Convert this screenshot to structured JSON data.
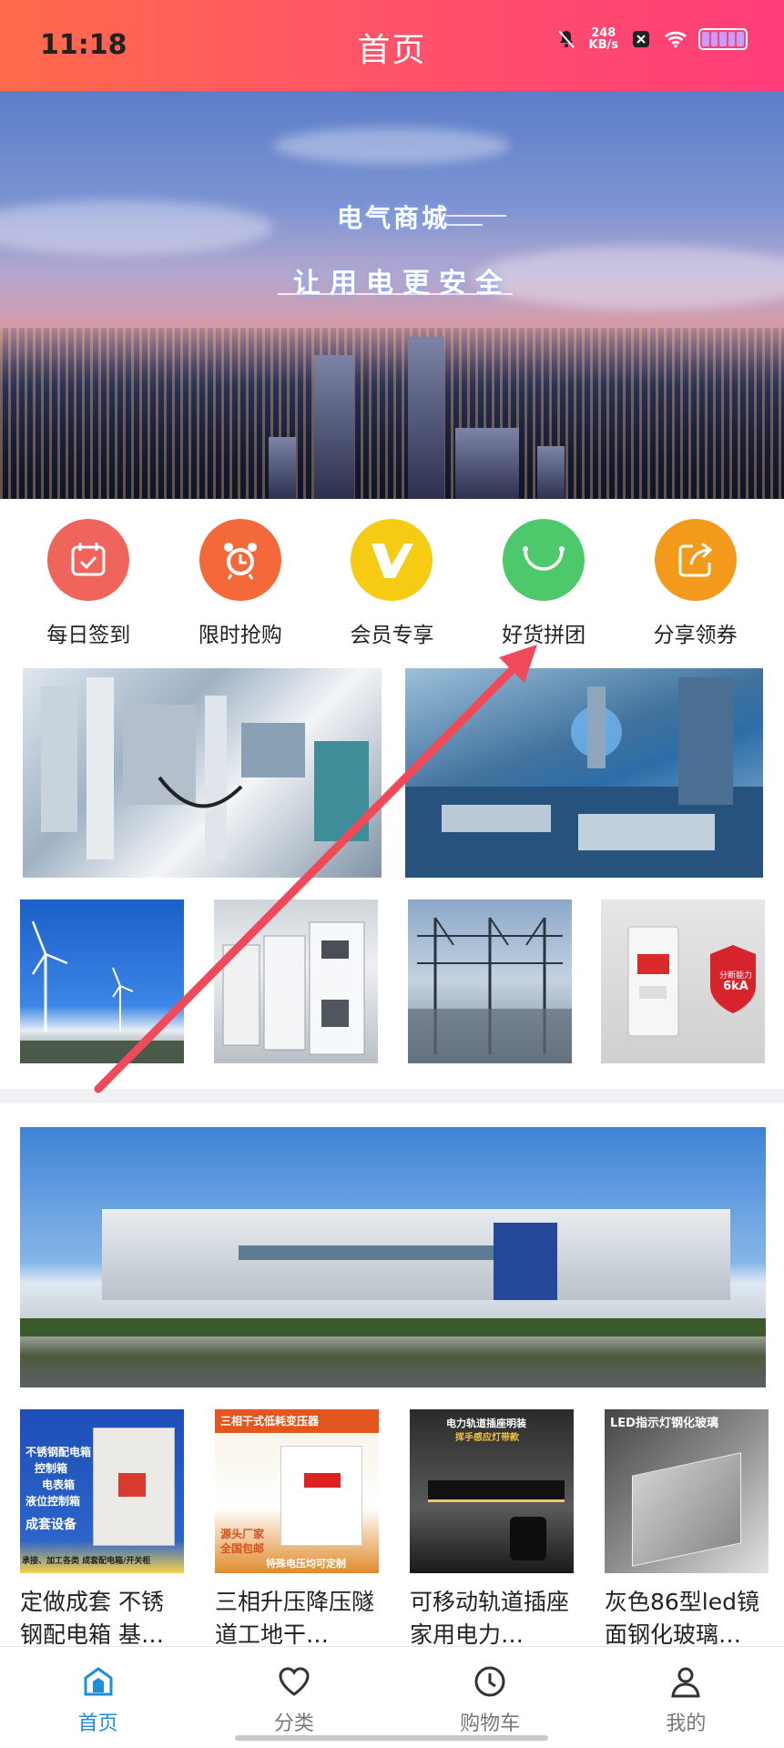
{
  "status": {
    "time": "11:18",
    "net_speed_value": "248",
    "net_speed_unit": "KB/s"
  },
  "header": {
    "title": "首页"
  },
  "hero": {
    "title": "电气商城",
    "subtitle": "让用电更安全"
  },
  "quick_actions": [
    {
      "label": "每日签到",
      "icon": "calendar-check-icon",
      "color": "#f0655b"
    },
    {
      "label": "限时抢购",
      "icon": "alarm-clock-icon",
      "color": "#f4693a"
    },
    {
      "label": "会员专享",
      "icon": "v-badge-icon",
      "color": "#f6cb14"
    },
    {
      "label": "好货拼团",
      "icon": "smile-bag-icon",
      "color": "#4dc86a"
    },
    {
      "label": "分享领券",
      "icon": "share-icon",
      "color": "#f39a1d"
    }
  ],
  "image_tiles": {
    "tile_breaker_badge_line1": "分断能力",
    "tile_breaker_badge_line2": "6kA"
  },
  "products": [
    {
      "title": "定做成套 不锈钢配电箱 基…",
      "img_lines": [
        "不锈钢配电箱",
        "控制箱",
        "电表箱",
        "液位控制箱",
        "成套设备",
        "承接、加工各类 成套配电箱/开关柜"
      ]
    },
    {
      "title": "三相升压降压隧道工地干…",
      "img_lines": [
        "三相干式低耗变压器",
        "源头厂家",
        "全国包邮",
        "特殊电压均可定制"
      ]
    },
    {
      "title": "可移动轨道插座家用电力…",
      "img_lines": [
        "电力轨道插座明装",
        "挥手感应灯带款"
      ]
    },
    {
      "title": "灰色86型led镜面钢化玻璃…",
      "img_lines": [
        "LED指示灯钢化玻璃"
      ]
    }
  ],
  "tabbar": [
    {
      "label": "首页",
      "icon": "home-icon",
      "active": true
    },
    {
      "label": "分类",
      "icon": "heart-icon",
      "active": false
    },
    {
      "label": "购物车",
      "icon": "clock-icon",
      "active": false
    },
    {
      "label": "我的",
      "icon": "user-icon",
      "active": false
    }
  ],
  "colors": {
    "header_gradient_start": "#ff6b4a",
    "header_gradient_end": "#ff3d7a",
    "tab_active": "#1e8fd6",
    "annotation_arrow": "#f04a5a"
  }
}
